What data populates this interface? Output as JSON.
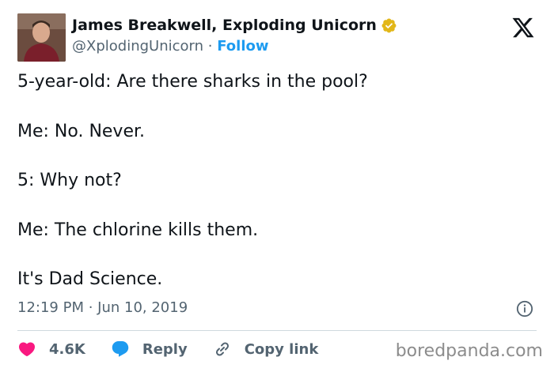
{
  "author": {
    "name": "James Breakwell, Exploding Unicorn",
    "handle": "@XplodingUnicorn",
    "separator": "·",
    "follow_label": "Follow"
  },
  "tweet": {
    "lines": [
      "5-year-old: Are there sharks in the pool?",
      "Me: No. Never.",
      "5: Why not?",
      "Me: The chlorine kills them.",
      "It's Dad Science."
    ],
    "timestamp": "12:19 PM · Jun 10, 2019"
  },
  "actions": {
    "likes": "4.6K",
    "reply_label": "Reply",
    "copy_link_label": "Copy link"
  },
  "watermark": "boredpanda.com",
  "colors": {
    "accent": "#1d9bf0",
    "heart": "#f91880",
    "verified": "#e2b719",
    "text": "#0f1419",
    "muted": "#536471"
  },
  "icons": [
    "verified-badge-icon",
    "x-logo-icon",
    "info-icon",
    "heart-icon",
    "reply-icon",
    "link-icon"
  ]
}
